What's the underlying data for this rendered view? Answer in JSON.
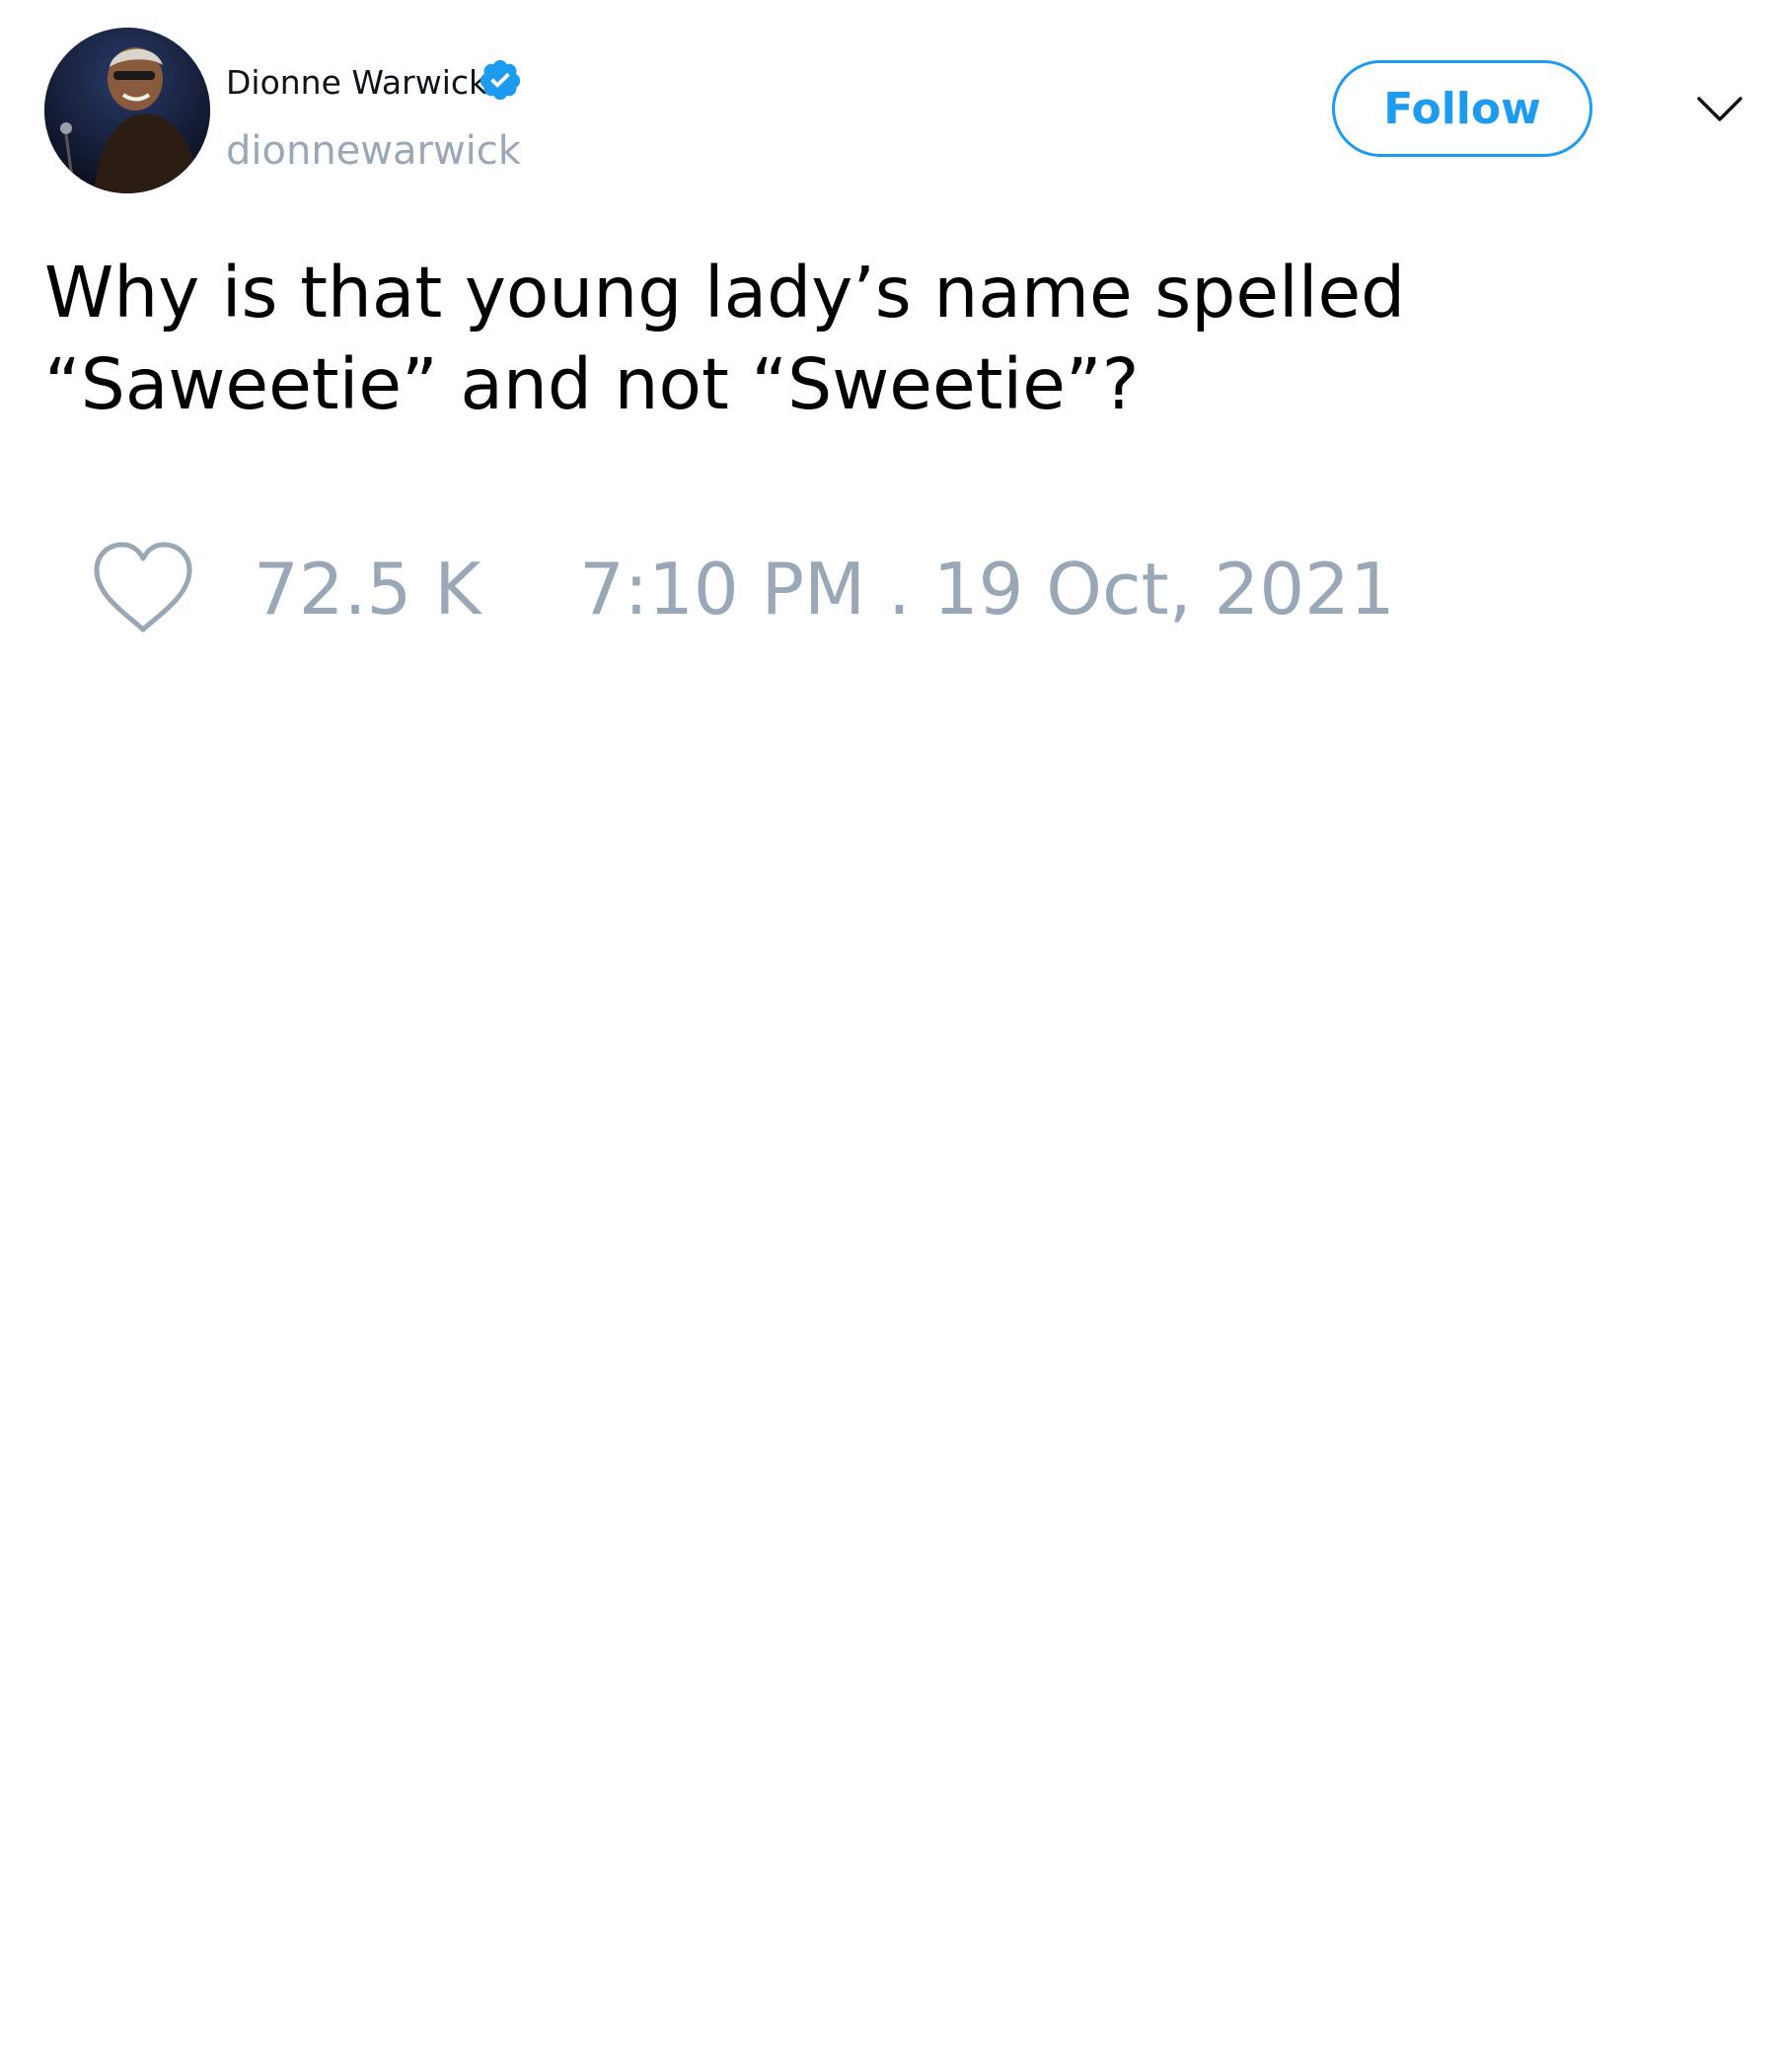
{
  "author": {
    "display_name": "Dionne Warwick",
    "handle": "dionnewarwick",
    "verified": true,
    "avatar_icon": "profile-photo"
  },
  "actions": {
    "follow_label": "Follow",
    "menu_icon": "chevron-down-icon"
  },
  "tweet": {
    "text_lines": [
      "Why is that young lady’s name spelled",
      "“Saweetie” and not “Sweetie”?"
    ]
  },
  "footer": {
    "like_icon": "heart-outline-icon",
    "like_count": "72.5 K",
    "timestamp": "7:10 PM . 19 Oct, 2021"
  },
  "colors": {
    "accent": "#1d9bf0",
    "muted": "#9aa7b6",
    "text": "#000000"
  }
}
